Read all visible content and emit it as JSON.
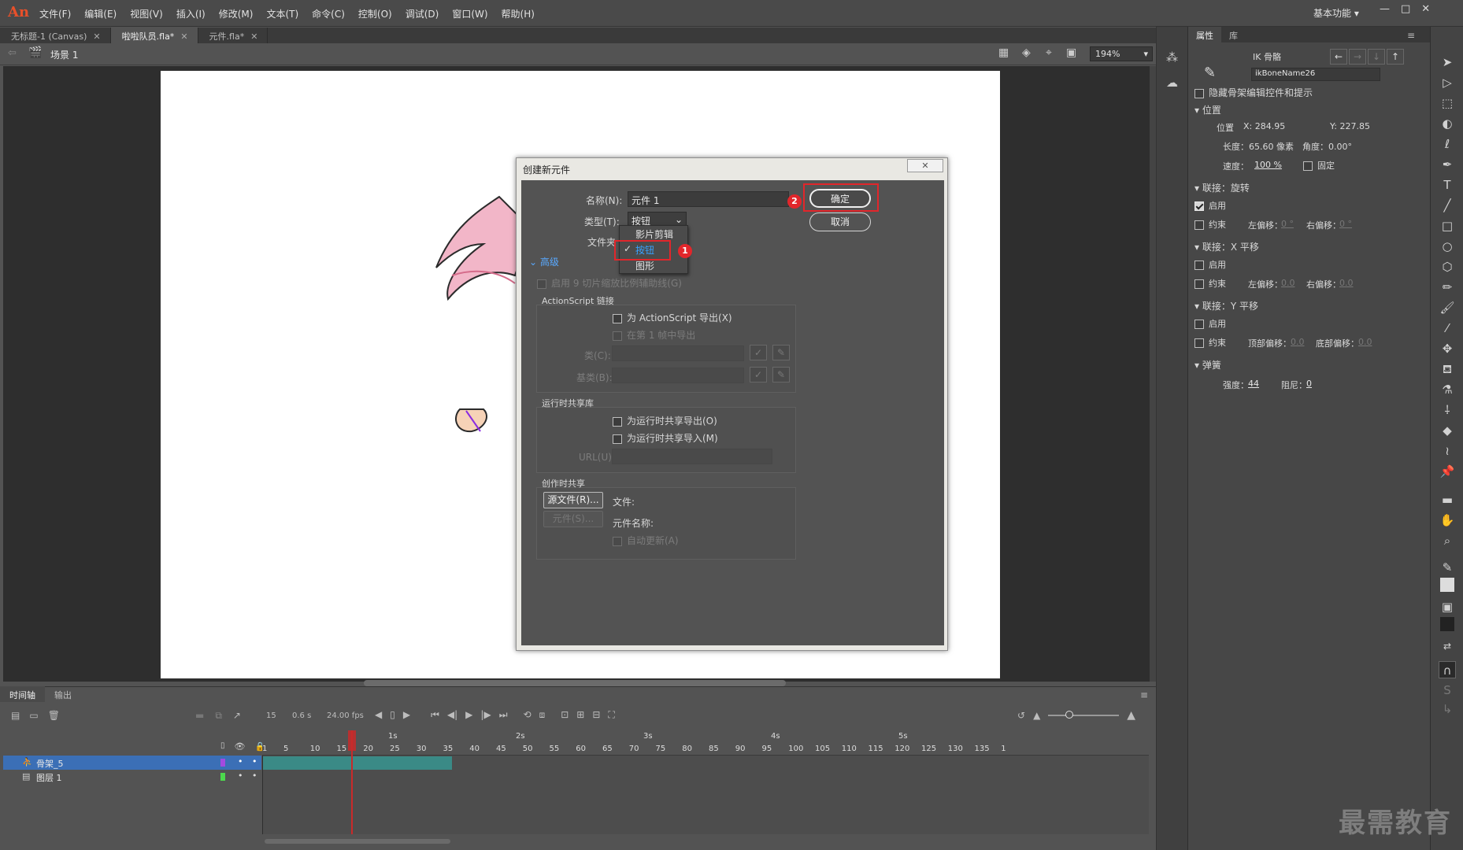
{
  "app": {
    "logo": "An",
    "workspace": "基本功能"
  },
  "menu": [
    "文件(F)",
    "编辑(E)",
    "视图(V)",
    "插入(I)",
    "修改(M)",
    "文本(T)",
    "命令(C)",
    "控制(O)",
    "调试(D)",
    "窗口(W)",
    "帮助(H)"
  ],
  "doc_tabs": [
    {
      "label": "无标题-1 (Canvas)",
      "active": false
    },
    {
      "label": "啦啦队员.fla*",
      "active": true
    },
    {
      "label": "元件.fla*",
      "active": false
    }
  ],
  "edit_bar": {
    "scene": "场景 1",
    "zoom": "194%"
  },
  "dialog": {
    "title": "创建新元件",
    "name_label": "名称(N):",
    "name_value": "元件 1",
    "type_label": "类型(T):",
    "type_value": "按钮",
    "folder_label": "文件夹",
    "type_options": [
      "影片剪辑",
      "按钮",
      "图形"
    ],
    "advanced": "高级",
    "enable_9slice": "启用 9 切片缩放比例辅助线(G)",
    "as_linkage": "ActionScript 链接",
    "export_as": "为 ActionScript 导出(X)",
    "export_frame1": "在第 1 帧中导出",
    "class_label": "类(C):",
    "base_label": "基类(B):",
    "runtime_share": "运行时共享库",
    "export_runtime": "为运行时共享导出(O)",
    "import_runtime": "为运行时共享导入(M)",
    "url_label": "URL(U):",
    "author_share": "创作时共享",
    "source_btn": "源文件(R)...",
    "file_label": "文件:",
    "symbol_btn": "元件(S)...",
    "symbol_name": "元件名称:",
    "auto_update": "自动更新(A)",
    "ok": "确定",
    "cancel": "取消",
    "badge1": "1",
    "badge2": "2"
  },
  "timeline": {
    "tabs": [
      "时间轴",
      "输出"
    ],
    "frame": "15",
    "time": "0.6 s",
    "fps": "24.00 fps",
    "layers": [
      {
        "name": "骨架_5",
        "selected": true
      },
      {
        "name": "图层 1",
        "selected": false
      }
    ],
    "ticks": [
      "1",
      "5",
      "10",
      "15",
      "20",
      "25",
      "30",
      "35",
      "40",
      "45",
      "50",
      "55",
      "60",
      "65",
      "70",
      "75",
      "80",
      "85",
      "90",
      "95",
      "100",
      "105",
      "110",
      "115",
      "120",
      "125",
      "130",
      "135",
      "1"
    ],
    "seconds": [
      "1s",
      "2s",
      "3s",
      "4s",
      "5s"
    ]
  },
  "properties": {
    "tabs": [
      "属性",
      "库"
    ],
    "ik_title": "IK 骨骼",
    "bone_name": "ikBoneName26",
    "hide_controls": "隐藏骨架编辑控件和提示",
    "position_section": "位置",
    "pos_label": "位置",
    "pos_x": "X: 284.95",
    "pos_y": "Y: 227.85",
    "length": "长度：65.60 像素",
    "angle": "角度：0.00°",
    "speed_label": "速度：",
    "speed_value": "100 %",
    "fixed": "固定",
    "joint_rotation": "联接：旋转",
    "enable": "启用",
    "constrain": "约束",
    "left_offset": "左偏移：",
    "right_offset": "右偏移：",
    "joint_x": "联接：X 平移",
    "joint_y": "联接：Y 平移",
    "top_offset": "顶部偏移：",
    "bottom_offset": "底部偏移：",
    "offset_deg": "0 °",
    "offset_zero": "0.0",
    "spring": "弹簧",
    "strength_label": "强度：",
    "strength": "44",
    "damping_label": "阻尼：",
    "damping": "0"
  },
  "watermark": "最需教育"
}
